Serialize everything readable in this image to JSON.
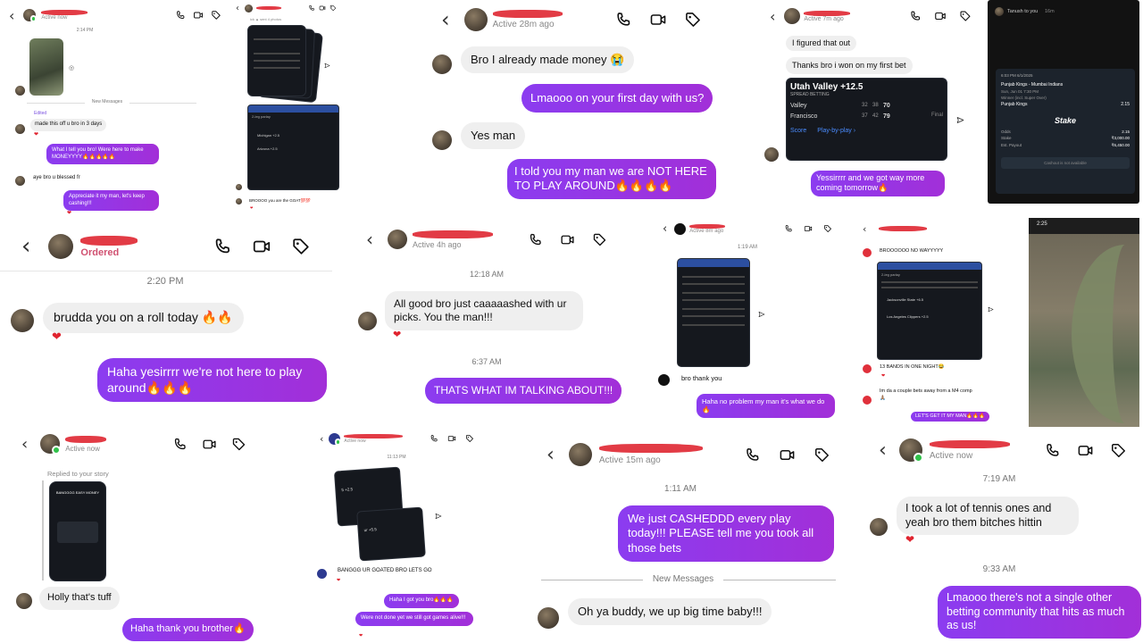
{
  "icons": {
    "back": "‹",
    "phone": "phone-icon",
    "video": "video-icon",
    "tag": "tag-icon",
    "forward": "share-icon",
    "heart": "❤"
  },
  "colors": {
    "bubble_out": "#9333ea",
    "bubble_in": "#efefef",
    "status_green": "#30c24a",
    "scribble": "#e0303b"
  },
  "p1": {
    "status": "Active now",
    "time": "2:14 PM",
    "new_messages": "New Messages",
    "edited": "Edited",
    "m1": "made this off u bro in 3 days",
    "m2": "What I tell you bro! Were here to make MONEYYYY🔥🔥🔥🔥🔥",
    "m3": "aye bro u blessed fr",
    "m4": "Appreciate it my man, let's keep cashing!!!"
  },
  "p2": {
    "status": "ick ▲ sent 4 photos",
    "parlay": "2-leg parlay",
    "row1": "Michigan +2.5",
    "row2": "Arizona +2.5",
    "m1": "BROOOO you are the GOAT💯💯"
  },
  "p3": {
    "status": "Active 28m ago",
    "m1": "Bro I already made money 😭",
    "m2": "Lmaooo on your first day with us?",
    "m3": "Yes man",
    "m4": "I told you my man we are NOT HERE TO PLAY AROUND🔥🔥🔥🔥"
  },
  "p4": {
    "status": "Active 7m ago",
    "m1": "I figured that out",
    "m2": "Thanks bro i won on my first bet",
    "card_title": "Utah Valley +12.5",
    "card_sub": "SPREAD BETTING",
    "team1": "Valley",
    "t1a": "32",
    "t1b": "38",
    "t1c": "70",
    "team2": "Francisco",
    "t2a": "37",
    "t2b": "42",
    "t2c": "79",
    "final": "Final",
    "score": "Score",
    "pbp": "Play-by-play ›",
    "m3": "Yessirrrr and we got way more coming tomorrow🔥"
  },
  "p5": {
    "sender": "Tanush to you",
    "age": "16m",
    "datetime": "6:03 PM 6/1/2025",
    "match": "Punjab Kings - Mumbai Indians",
    "when": "Sun, Jun 01 7:30 PM",
    "market": "Winner (incl. Super Over)",
    "pick": "Punjab Kings",
    "odds_val": "2.15",
    "brand": "Stake",
    "l_odds": "Odds",
    "v_odds": "2.15",
    "l_stake": "Stake",
    "v_stake": "₹3,000.00",
    "l_payout": "Est. Payout",
    "v_payout": "₹6,450.00",
    "cashout": "Cashout is not available"
  },
  "p6": {
    "status": "Ordered",
    "time": "2:20 PM",
    "m1": "brudda you on a roll today 🔥🔥",
    "m2": "Haha yesirrrr we're not here to play around🔥🔥🔥"
  },
  "p7": {
    "status": "Active 4h ago",
    "t1": "12:18 AM",
    "m1": "All good bro just caaaaashed with ur picks. You the man!!!",
    "t2": "6:37 AM",
    "m2": "THATS WHAT IM TALKING ABOUT!!!"
  },
  "p8": {
    "status": "Active 8m ago",
    "time": "1:19 AM",
    "m1": "bro thank you",
    "m2": "Haha no problem my man it's what we do🔥"
  },
  "p9": {
    "m1": "BROOOOOO NO WAYYYYY",
    "parlay": "2-leg parlay",
    "leg1": "Jacksonville State +6.5",
    "leg2": "Los Angeles Clippers +2.5",
    "m2": "13 BANDS IN ONE NIGHT😂",
    "m3": "Im da a couple bets away from a M4 comp 🙏🏽",
    "m4": "LET'S GET IT MY MAN🔥🔥🔥"
  },
  "p10": {
    "time": "2:25"
  },
  "p11": {
    "status": "Active now",
    "replied": "Replied to your story",
    "story": "BANGGGG EASY MONEY",
    "m1": "Holly that's tuff",
    "m2": "Haha thank you brother🔥"
  },
  "p12": {
    "status": "Active now",
    "time": "11:13 PM",
    "m1": "BANGGG UR GOATED BRO LETS GO",
    "m2": "Haha I got you bro🔥🔥🔥",
    "m3": "Were not done yet we still got games alive!!!"
  },
  "p13": {
    "status": "Active 15m ago",
    "time": "1:11 AM",
    "m1": "We just CASHEDDD every play today!!! PLEASE tell me you took all those bets",
    "divider": "New Messages",
    "m2": "Oh ya buddy, we up big time baby!!!"
  },
  "p14": {
    "status": "Active now",
    "t1": "7:19 AM",
    "m1": "I took a lot of tennis ones and yeah bro them bitches hittin",
    "t2": "9:33 AM",
    "m2": "Lmaooo there's not a single other betting community that hits as much as us!"
  }
}
